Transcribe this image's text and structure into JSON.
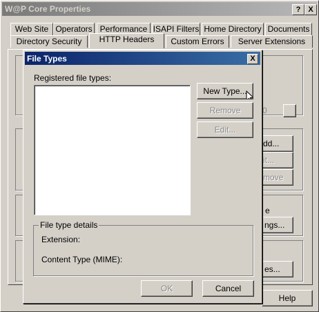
{
  "window": {
    "title": "W@P Core Properties",
    "help_button": "?",
    "close_button": "X"
  },
  "tabs": {
    "row1": [
      "Web Site",
      "Operators",
      "Performance",
      "ISAPI Filters",
      "Home Directory",
      "Documents"
    ],
    "row2": [
      "Directory Security",
      "HTTP Headers",
      "Custom Errors",
      "Server Extensions"
    ]
  },
  "background": {
    "add_partial": "dd...",
    "edit_partial": "it...",
    "remove_partial": "move",
    "settings_partial": "ngs...",
    "e_partial": "e",
    "types_partial": "es...",
    "zero_partial": "0",
    "help_button": "Help"
  },
  "dialog": {
    "title": "File Types",
    "close_button": "X",
    "registered_label": "Registered file types:",
    "new_type_button": "New Type...",
    "remove_button": "Remove",
    "edit_button": "Edit...",
    "details_group": "File type details",
    "extension_label": "Extension:",
    "content_type_label": "Content Type (MIME):",
    "ok_button": "OK",
    "cancel_button": "Cancel"
  }
}
